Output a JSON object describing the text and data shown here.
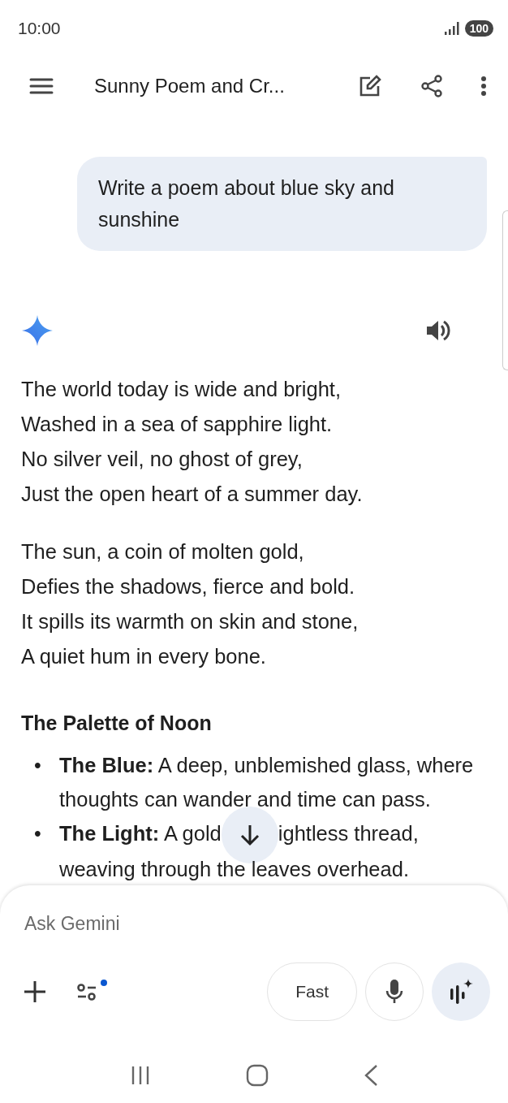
{
  "status_bar": {
    "time": "10:00",
    "battery": "100"
  },
  "header": {
    "title": "Sunny Poem and Cr..."
  },
  "prompt": {
    "text": "Write a poem about blue sky and sunshine"
  },
  "response": {
    "stanzas": [
      [
        "The world today is wide and bright,",
        "Washed in a sea of sapphire light.",
        "No silver veil, no ghost of grey,",
        "Just the open heart of a summer day."
      ],
      [
        "The sun, a coin of molten gold,",
        "Defies the shadows, fierce and bold.",
        "It spills its warmth on skin and stone,",
        "A quiet hum in every bone."
      ]
    ],
    "heading": "The Palette of Noon",
    "bullets": [
      {
        "marker": "•",
        "lines": [
          [
            "**The Blue:** A deep, unblemished glass, where thoughts can wander and time can pass."
          ]
        ]
      },
      {
        "marker": "•",
        "lines": [
          [
            "**The Light:** A gold",
            "ightless thread,"
          ],
          [
            "weaving through the leaves overhead."
          ]
        ]
      }
    ]
  },
  "composer": {
    "placeholder": "Ask Gemini",
    "tools_indicator": true,
    "mode": "Fast"
  }
}
